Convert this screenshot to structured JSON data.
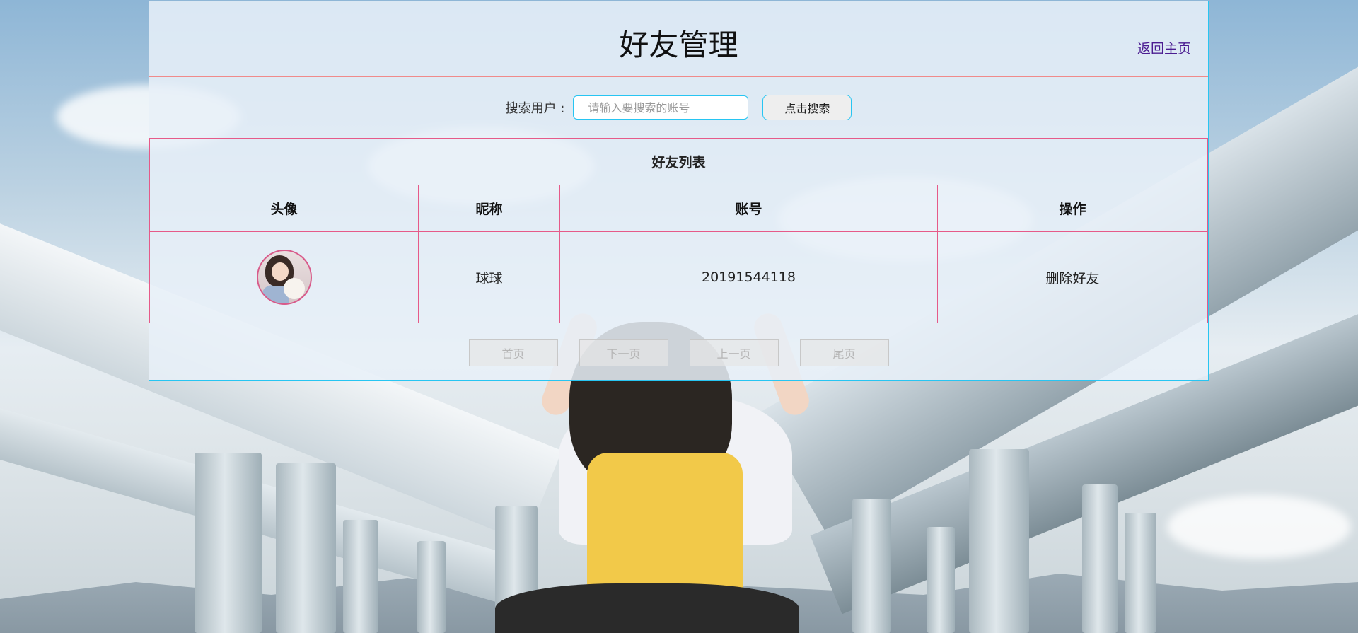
{
  "page": {
    "title": "好友管理",
    "home_link": "返回主页"
  },
  "search": {
    "label": "搜索用户 :",
    "placeholder": "请输入要搜索的账号",
    "value": "",
    "button_label": "点击搜索"
  },
  "friends_table": {
    "caption": "好友列表",
    "columns": [
      "头像",
      "昵称",
      "账号",
      "操作"
    ],
    "rows": [
      {
        "avatar_icon": "user-avatar",
        "nickname": "球球",
        "account": "20191544118",
        "action": "删除好友"
      }
    ]
  },
  "pager": {
    "first": "首页",
    "next": "下一页",
    "prev": "上一页",
    "last": "尾页"
  },
  "colors": {
    "panel_border": "#27c5f2",
    "table_border": "#e65a89",
    "link": "#4b1d91"
  }
}
